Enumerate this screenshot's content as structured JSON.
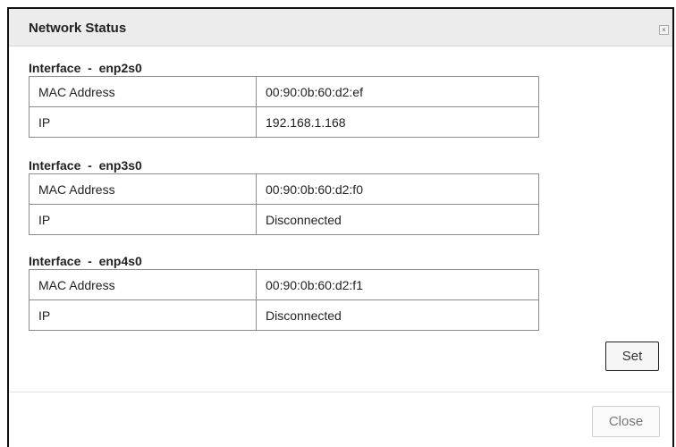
{
  "dialog": {
    "title": "Network Status",
    "close_icon": "close-icon",
    "close_glyph": "×"
  },
  "interfaces": [
    {
      "heading": "Interface  -  enp2s0",
      "mac_label": "MAC Address",
      "mac_value": "00:90:0b:60:d2:ef",
      "ip_label": "IP",
      "ip_value": "192.168.1.168"
    },
    {
      "heading": "Interface  -  enp3s0",
      "mac_label": "MAC Address",
      "mac_value": "00:90:0b:60:d2:f0",
      "ip_label": "IP",
      "ip_value": "Disconnected"
    },
    {
      "heading": "Interface  -  enp4s0",
      "mac_label": "MAC Address",
      "mac_value": "00:90:0b:60:d2:f1",
      "ip_label": "IP",
      "ip_value": "Disconnected"
    }
  ],
  "buttons": {
    "set_label": "Set",
    "close_label": "Close"
  }
}
